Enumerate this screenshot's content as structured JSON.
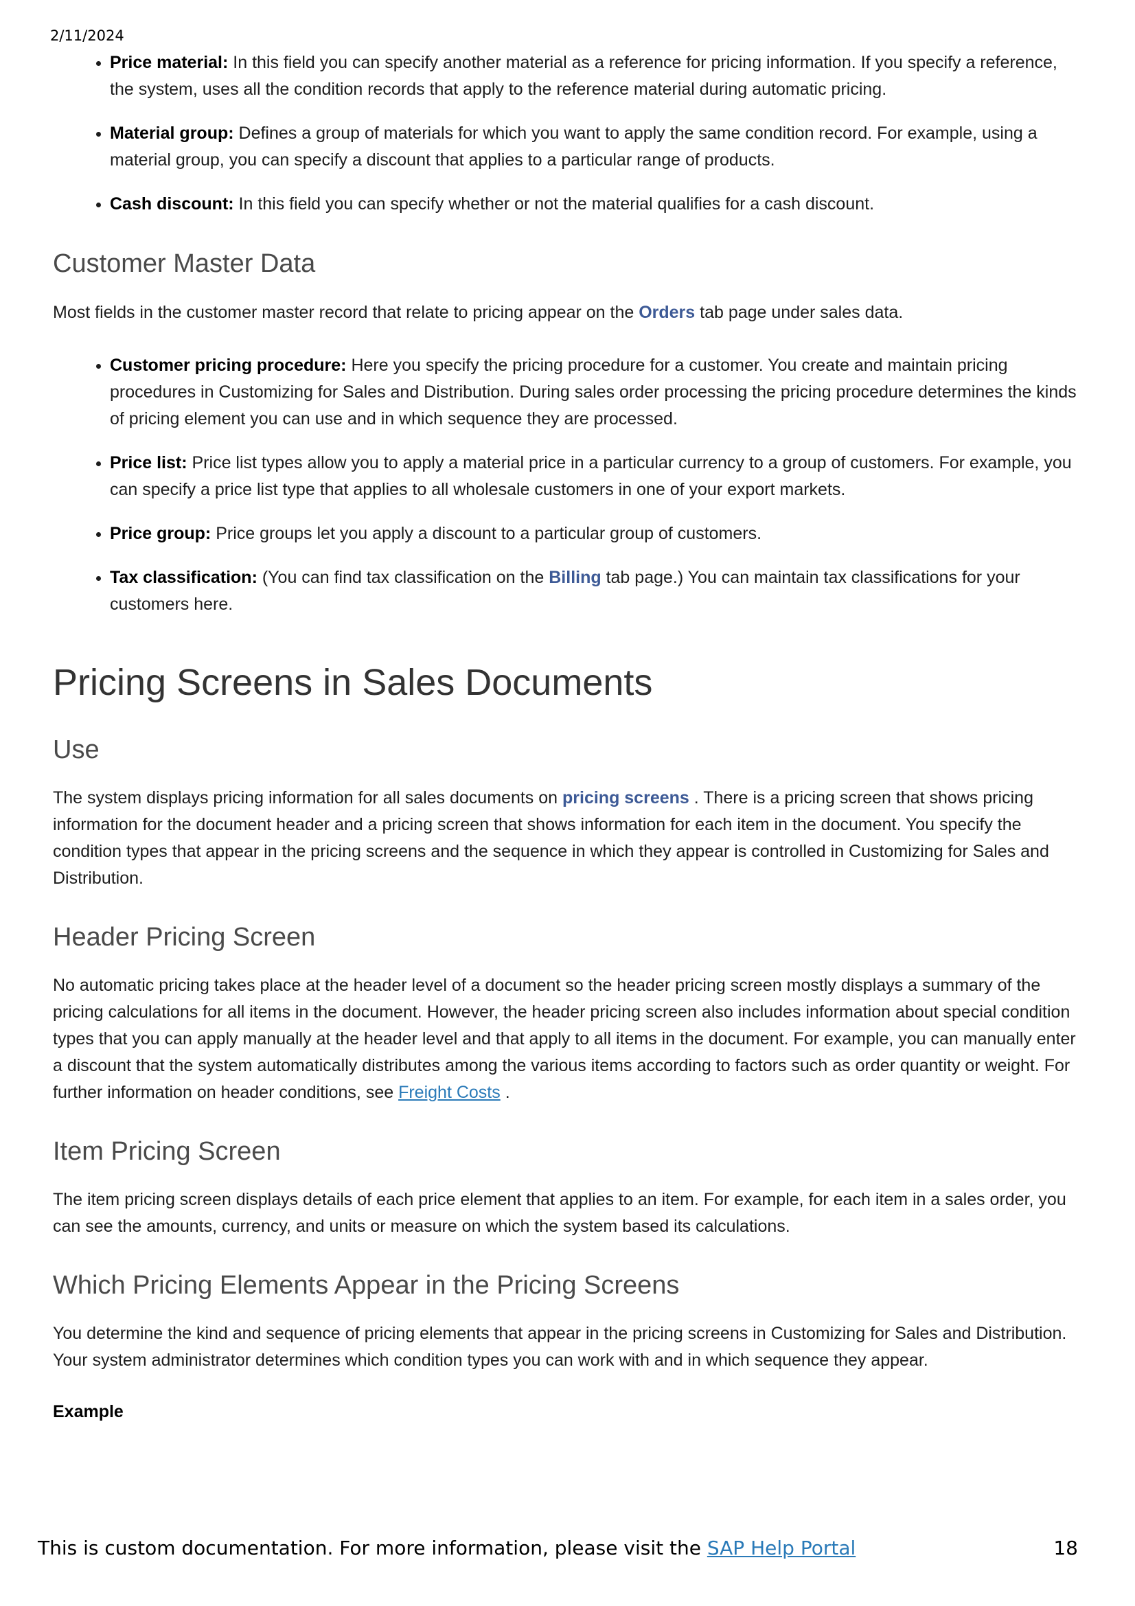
{
  "header": {
    "date": "2/11/2024"
  },
  "top_list": [
    {
      "term": "Price material:",
      "text": " In this field you can specify another material as a reference for pricing information. If you specify a reference, the system, uses all the condition records that apply to the reference material during automatic pricing."
    },
    {
      "term": "Material group:",
      "text": " Defines a group of materials for which you want to apply the same condition record. For example, using a material group, you can specify a discount that applies to a particular range of products."
    },
    {
      "term": "Cash discount:",
      "text": " In this field you can specify whether or not the material qualifies for a cash discount."
    }
  ],
  "customer_master": {
    "heading": "Customer Master Data",
    "intro_pre": "Most fields in the customer master record that relate to pricing appear on the ",
    "intro_ref": "Orders",
    "intro_post": " tab page under sales data.",
    "items": [
      {
        "term": "Customer pricing procedure:",
        "text": " Here you specify the pricing procedure for a customer. You create and maintain pricing procedures in Customizing for Sales and Distribution. During sales order processing the pricing procedure determines the kinds of pricing element you can use and in which sequence they are processed."
      },
      {
        "term": "Price list:",
        "text": " Price list types allow you to apply a material price in a particular currency to a group of customers. For example, you can specify a price list type that applies to all wholesale customers in one of your export markets."
      },
      {
        "term": "Price group:",
        "text": " Price groups let you apply a discount to a particular group of customers."
      }
    ],
    "tax": {
      "term": "Tax classification:",
      "pre": " (You can find tax classification on the ",
      "ref": "Billing",
      "post": " tab page.) You can maintain tax classifications for your customers here."
    }
  },
  "pricing_screens": {
    "title": "Pricing Screens in Sales Documents",
    "use_heading": "Use",
    "use_pre": "The system displays pricing information for all sales documents on ",
    "use_ref": "pricing screens",
    "use_post": " . There is a pricing screen that shows pricing information for the document header and a pricing screen that shows information for each item in the document. You specify the condition types that appear in the pricing screens and the sequence in which they appear is controlled in Customizing for Sales and Distribution.",
    "header_heading": "Header Pricing Screen",
    "header_text": "No automatic pricing takes place at the header level of a document so the header pricing screen mostly displays a summary of the pricing calculations for all items in the document. However, the header pricing screen also includes information about special condition types that you can apply manually at the header level and that apply to all items in the document. For example, you can manually enter a discount that the system automatically distributes among the various items according to factors such as order quantity or weight. For further information on header conditions, see ",
    "header_link": "Freight Costs",
    "header_post": " .",
    "item_heading": "Item Pricing Screen",
    "item_text": "The item pricing screen displays details of each price element that applies to an item. For example, for each item in a sales order, you can see the amounts, currency, and units or measure on which the system based its calculations.",
    "which_heading": "Which Pricing Elements Appear in the Pricing Screens",
    "which_text": "You determine the kind and sequence of pricing elements that appear in the pricing screens in Customizing for Sales and Distribution. Your system administrator determines which condition types you can work with and in which sequence they appear.",
    "example_label": "Example"
  },
  "footer": {
    "text": "This is custom documentation. For more information, please visit the ",
    "link": "SAP Help Portal",
    "page": "18"
  }
}
